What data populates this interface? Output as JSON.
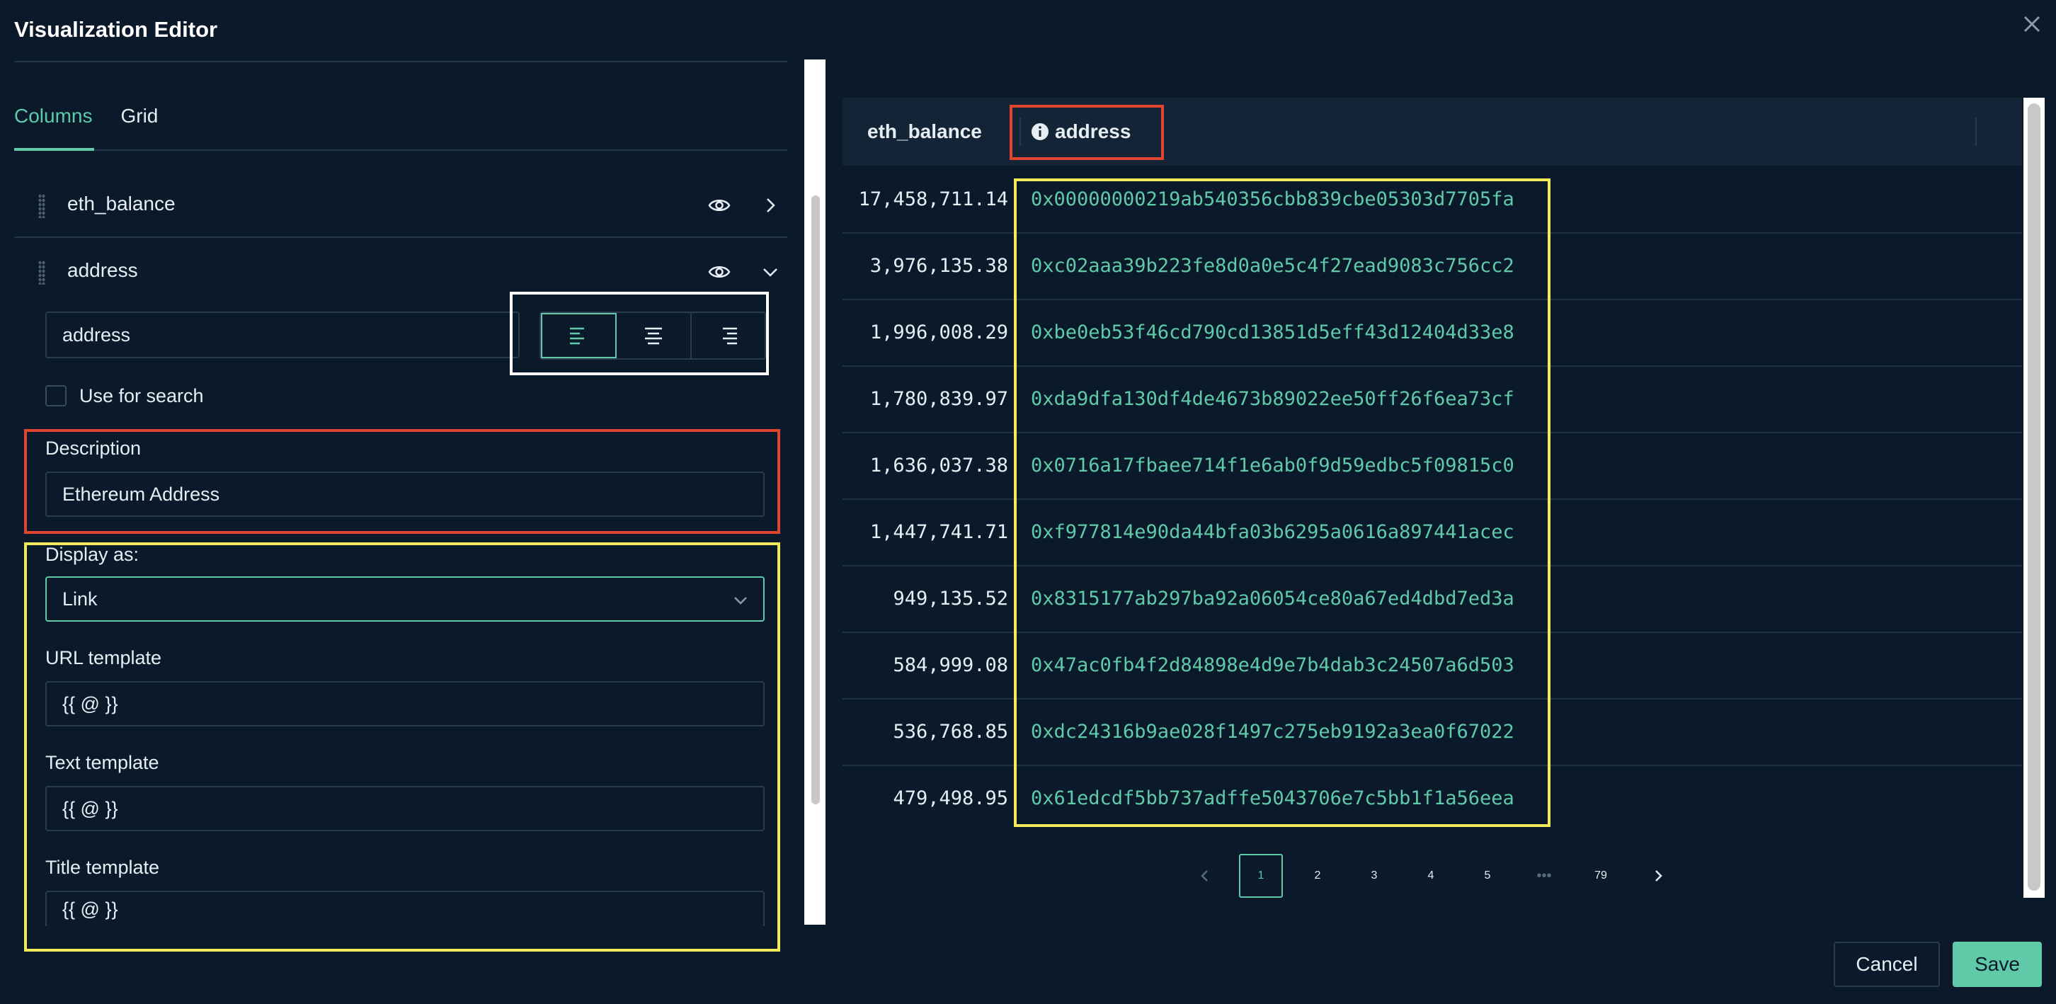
{
  "window": {
    "title": "Visualization Editor"
  },
  "tabs": [
    {
      "label": "Columns"
    },
    {
      "label": "Grid"
    }
  ],
  "columns": [
    {
      "name": "eth_balance"
    },
    {
      "name": "address"
    }
  ],
  "column_settings": {
    "title_value": "address",
    "use_for_search_label": "Use for search",
    "description_label": "Description",
    "description_value": "Ethereum Address",
    "display_as_label": "Display as:",
    "display_as_value": "Link",
    "url_template_label": "URL template",
    "url_template_value": "{{ @ }}",
    "text_template_label": "Text template",
    "text_template_value": "{{ @ }}",
    "title_template_label": "Title template",
    "title_template_value": "{{ @ }}"
  },
  "table": {
    "headers": [
      "eth_balance",
      "address"
    ],
    "rows": [
      {
        "eth_balance": "17,458,711.14",
        "address": "0x00000000219ab540356cbb839cbe05303d7705fa"
      },
      {
        "eth_balance": "3,976,135.38",
        "address": "0xc02aaa39b223fe8d0a0e5c4f27ead9083c756cc2"
      },
      {
        "eth_balance": "1,996,008.29",
        "address": "0xbe0eb53f46cd790cd13851d5eff43d12404d33e8"
      },
      {
        "eth_balance": "1,780,839.97",
        "address": "0xda9dfa130df4de4673b89022ee50ff26f6ea73cf"
      },
      {
        "eth_balance": "1,636,037.38",
        "address": "0x0716a17fbaee714f1e6ab0f9d59edbc5f09815c0"
      },
      {
        "eth_balance": "1,447,741.71",
        "address": "0xf977814e90da44bfa03b6295a0616a897441acec"
      },
      {
        "eth_balance": "949,135.52",
        "address": "0x8315177ab297ba92a06054ce80a67ed4dbd7ed3a"
      },
      {
        "eth_balance": "584,999.08",
        "address": "0x47ac0fb4f2d84898e4d9e7b4dab3c24507a6d503"
      },
      {
        "eth_balance": "536,768.85",
        "address": "0xdc24316b9ae028f1497c275eb9192a3ea0f67022"
      },
      {
        "eth_balance": "479,498.95",
        "address": "0x61edcdf5bb737adffe5043706e7c5bb1f1a56eea"
      }
    ]
  },
  "pagination": {
    "pages": [
      "1",
      "2",
      "3",
      "4",
      "5",
      "79"
    ],
    "ellipsis": "•••",
    "current": "1"
  },
  "footer": {
    "cancel_label": "Cancel",
    "save_label": "Save"
  },
  "colors": {
    "accent": "#5fc9a8",
    "background": "#0b1a2b",
    "highlight_red": "#e0452f",
    "highlight_yellow": "#f2ea5a"
  }
}
